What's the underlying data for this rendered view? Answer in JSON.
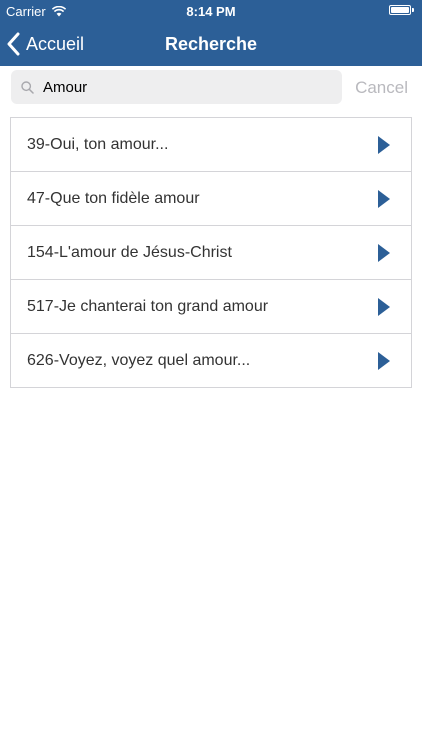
{
  "status_bar": {
    "carrier": "Carrier",
    "time": "8:14 PM",
    "battery_level": 1.0
  },
  "navbar": {
    "back_label": "Accueil",
    "title": "Recherche"
  },
  "search": {
    "value": "Amour",
    "cancel_label": "Cancel"
  },
  "results": [
    {
      "label": "39-Oui, ton amour..."
    },
    {
      "label": "47-Que ton fidèle amour"
    },
    {
      "label": "154-L'amour de Jésus-Christ"
    },
    {
      "label": "517-Je chanterai ton grand amour"
    },
    {
      "label": "626-Voyez, voyez quel amour..."
    }
  ],
  "colors": {
    "nav_bar": "#2c5f97",
    "accent": "#2c5f97",
    "cancel_text": "#b9b9be"
  },
  "icons": {
    "back": "chevron-left-icon",
    "search": "magnifier-icon",
    "row": "play-arrow-icon",
    "wifi": "wifi-icon",
    "battery": "battery-icon"
  }
}
